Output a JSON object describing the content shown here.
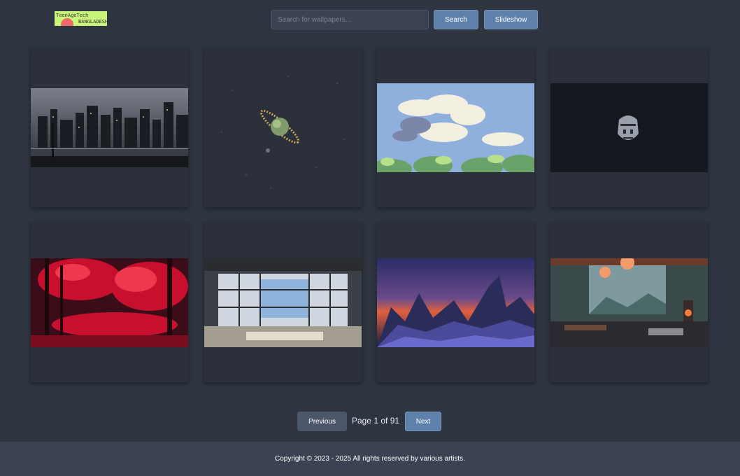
{
  "logo": {
    "line1": "TeenAgeTech",
    "line2": "BANGLADESH"
  },
  "search": {
    "placeholder": "Search for wallpapers...",
    "button_label": "Search"
  },
  "slideshow_label": "Slideshow",
  "wallpapers": [
    {
      "description": "pixel city skyline at night"
    },
    {
      "description": "tiny planet in space"
    },
    {
      "description": "pixel clouds and trees"
    },
    {
      "description": "metal mask on dark background"
    },
    {
      "description": "red autumn forest"
    },
    {
      "description": "sunlit room interior"
    },
    {
      "description": "purple mountains under starry sky"
    },
    {
      "description": "lofi cabin room"
    }
  ],
  "pagination": {
    "previous_label": "Previous",
    "page_text": "Page 1 of 91",
    "next_label": "Next"
  },
  "footer": {
    "copyright": "Copyright © 2023 - 2025 All rights reserved by various artists."
  },
  "colors": {
    "background": "#2e3440",
    "card": "#2b303b",
    "accent": "#5e81ac",
    "footer": "#3b4252"
  }
}
